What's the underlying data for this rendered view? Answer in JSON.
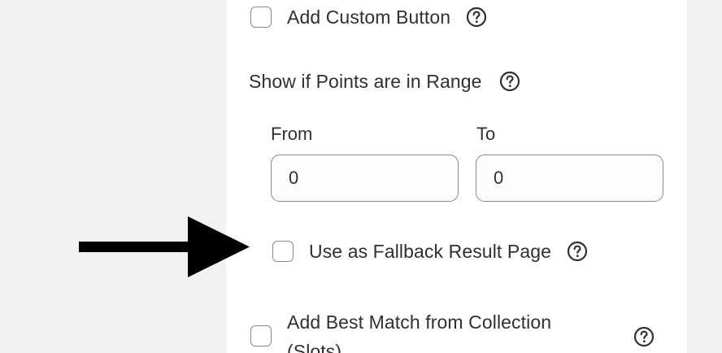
{
  "custom_button": {
    "label": "Add Custom Button"
  },
  "points_range": {
    "label": "Show if Points are in Range",
    "from_label": "From",
    "to_label": "To",
    "from_value": "0",
    "to_value": "0"
  },
  "fallback": {
    "label": "Use as Fallback Result Page"
  },
  "best_match": {
    "label_line1": "Add Best Match from Collection",
    "label_line2": "(Slots)"
  },
  "icons": {
    "help": "question-circle-icon",
    "arrow": "right-arrow-annotation"
  },
  "colors": {
    "background": "#f1f1f1",
    "panel": "#ffffff",
    "text": "#303030",
    "border": "#8a8a8a",
    "arrow": "#000000"
  }
}
